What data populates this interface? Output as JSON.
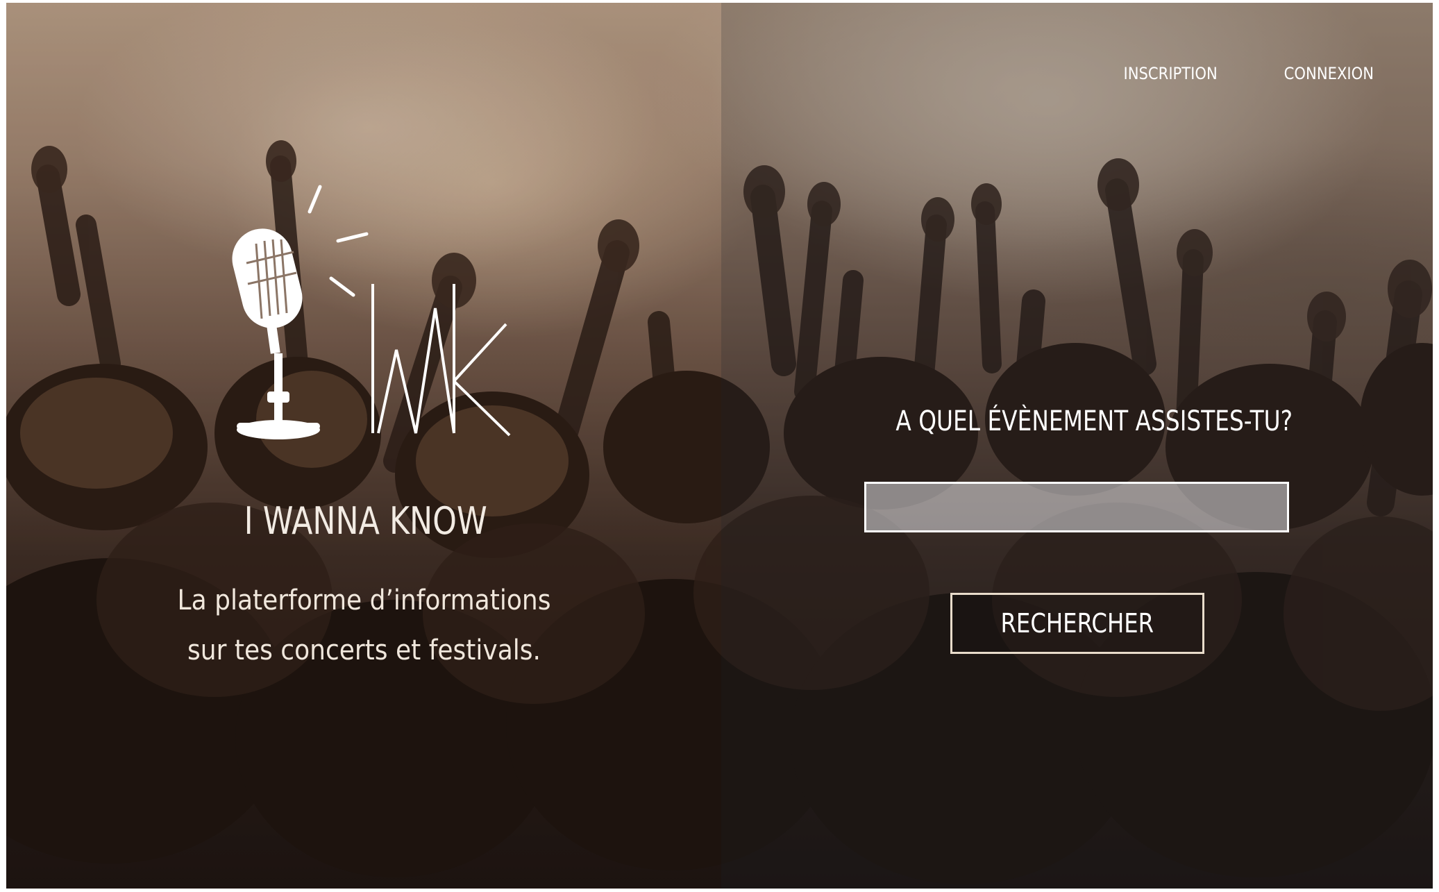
{
  "nav": {
    "signup_label": "INSCRIPTION",
    "login_label": "CONNEXION"
  },
  "brand": {
    "logo_icon": "microphone-icon",
    "monogram": "IWK",
    "name": "I WANNA KNOW",
    "tagline_line1": "La platerforme d’informations",
    "tagline_line2": "sur tes concerts et festivals."
  },
  "search": {
    "question": "A QUEL ÉVÈNEMENT ASSISTES-TU?",
    "input_value": "",
    "button_label": "RECHERCHER"
  },
  "colors": {
    "text": "#ffffff",
    "accent_border": "#e9dccb",
    "input_fill": "#e1e1e6"
  }
}
